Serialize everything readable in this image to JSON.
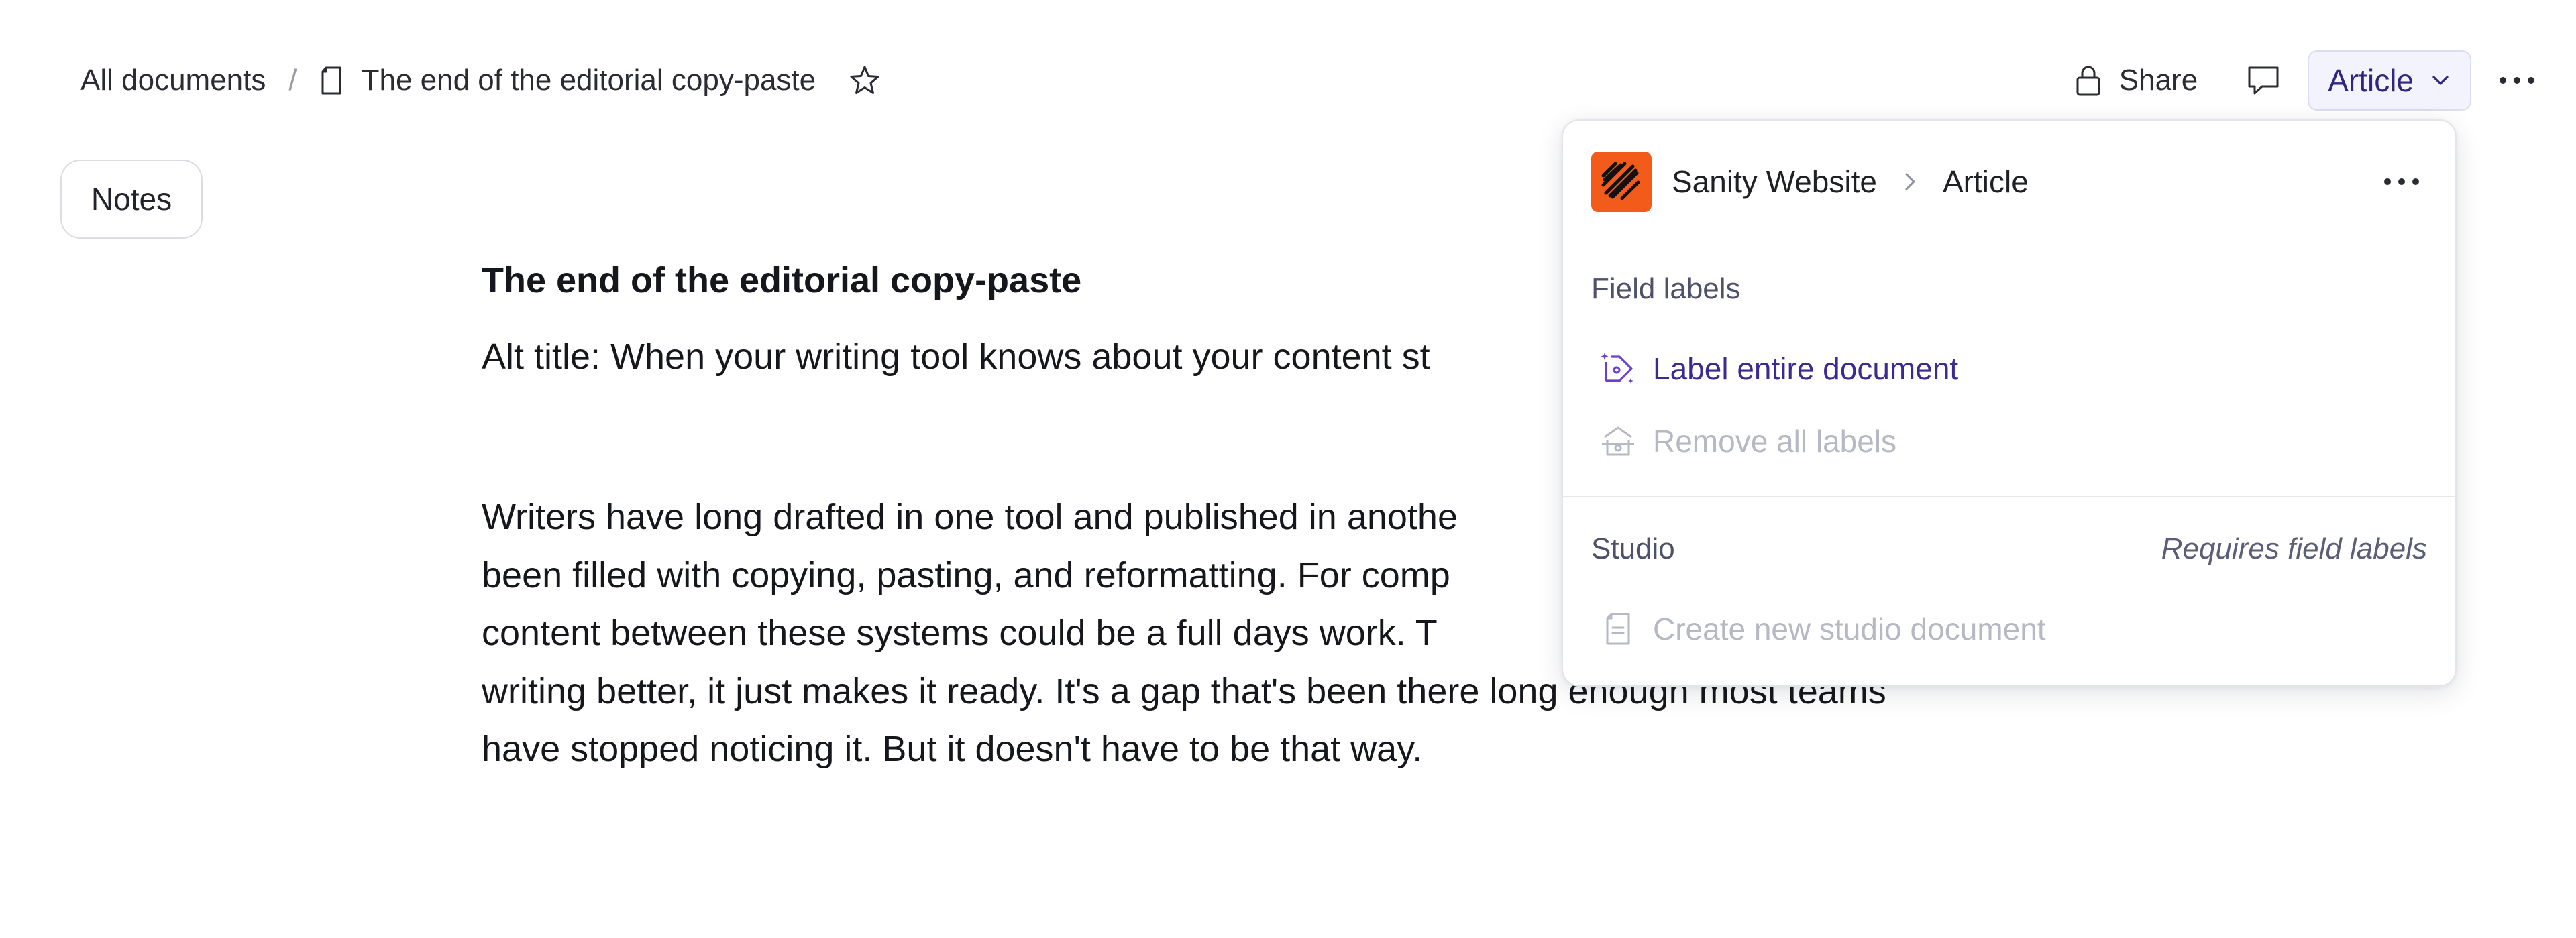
{
  "breadcrumb": {
    "root": "All documents",
    "separator": "/",
    "document": "The end of the editorial copy-paste"
  },
  "top_actions": {
    "share_label": "Share",
    "type_label": "Article"
  },
  "notes_button": "Notes",
  "document": {
    "title": "The end of the editorial copy-paste",
    "alt_title": "Alt title: When your writing tool knows about your content st",
    "paragraph_lines": [
      "Writers have long drafted in one tool and published in anothe",
      "been filled with copying, pasting, and reformatting. For comp",
      "content between these systems could be a full days work. T",
      "writing better, it just makes it ready. It's a gap that's been there long enough most teams",
      "have stopped noticing it. But it doesn't have to be that way."
    ]
  },
  "menu": {
    "app_name": "Sanity Website",
    "path_type": "Article",
    "field_labels": {
      "heading": "Field labels",
      "label_all": "Label entire document",
      "remove_all": "Remove all labels"
    },
    "studio": {
      "heading": "Studio",
      "note": "Requires field labels",
      "create": "Create new studio document"
    }
  },
  "colors": {
    "accent": "#3a2a91",
    "logo": "#f35b1a",
    "disabled": "#b6b8c4",
    "article_button_bg": "#f3f3fd"
  },
  "icons": {
    "doc": "document-icon",
    "star": "star-icon",
    "lock": "lock-icon",
    "comment": "comment-icon",
    "chevron": "chevron-down-icon",
    "more": "ellipsis-icon",
    "label": "tag-sparkle-icon",
    "remove_label": "tag-remove-icon",
    "studio_doc": "studio-document-icon"
  }
}
